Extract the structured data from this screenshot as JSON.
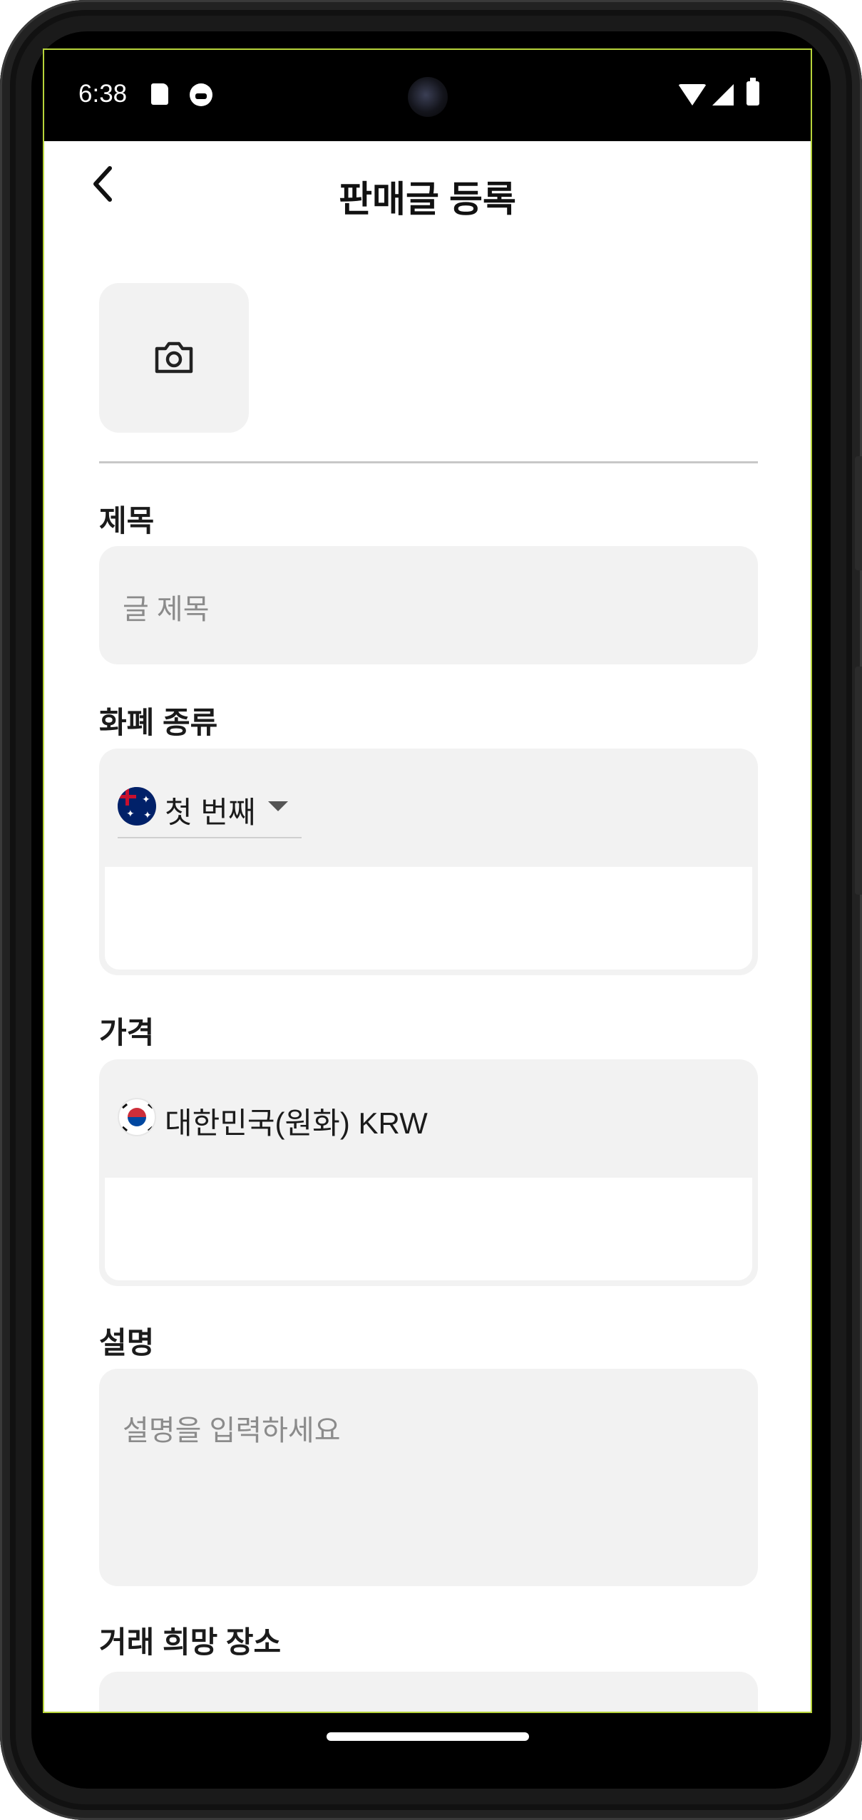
{
  "status_bar": {
    "time": "6:38",
    "icons": [
      "sd-card-icon",
      "cat-icon",
      "wifi-icon",
      "signal-icon",
      "battery-icon"
    ]
  },
  "app_bar": {
    "title": "판매글 등록",
    "back_icon": "back-arrow-icon"
  },
  "photo": {
    "icon": "camera-icon"
  },
  "form": {
    "title_label": "제목",
    "title_placeholder": "글 제목",
    "currency_label": "화폐 종류",
    "currency_selected": "첫 번째",
    "currency_flag": "australia-flag",
    "price_label": "가격",
    "price_currency": "대한민국(원화) KRW",
    "price_flag": "korea-flag",
    "description_label": "설명",
    "description_placeholder": "설명을 입력하세요",
    "location_label": "거래 희망 장소"
  },
  "colors": {
    "field_background": "#f2f2f2",
    "text_primary": "#1b1b1b",
    "placeholder": "#8b8b8b"
  }
}
